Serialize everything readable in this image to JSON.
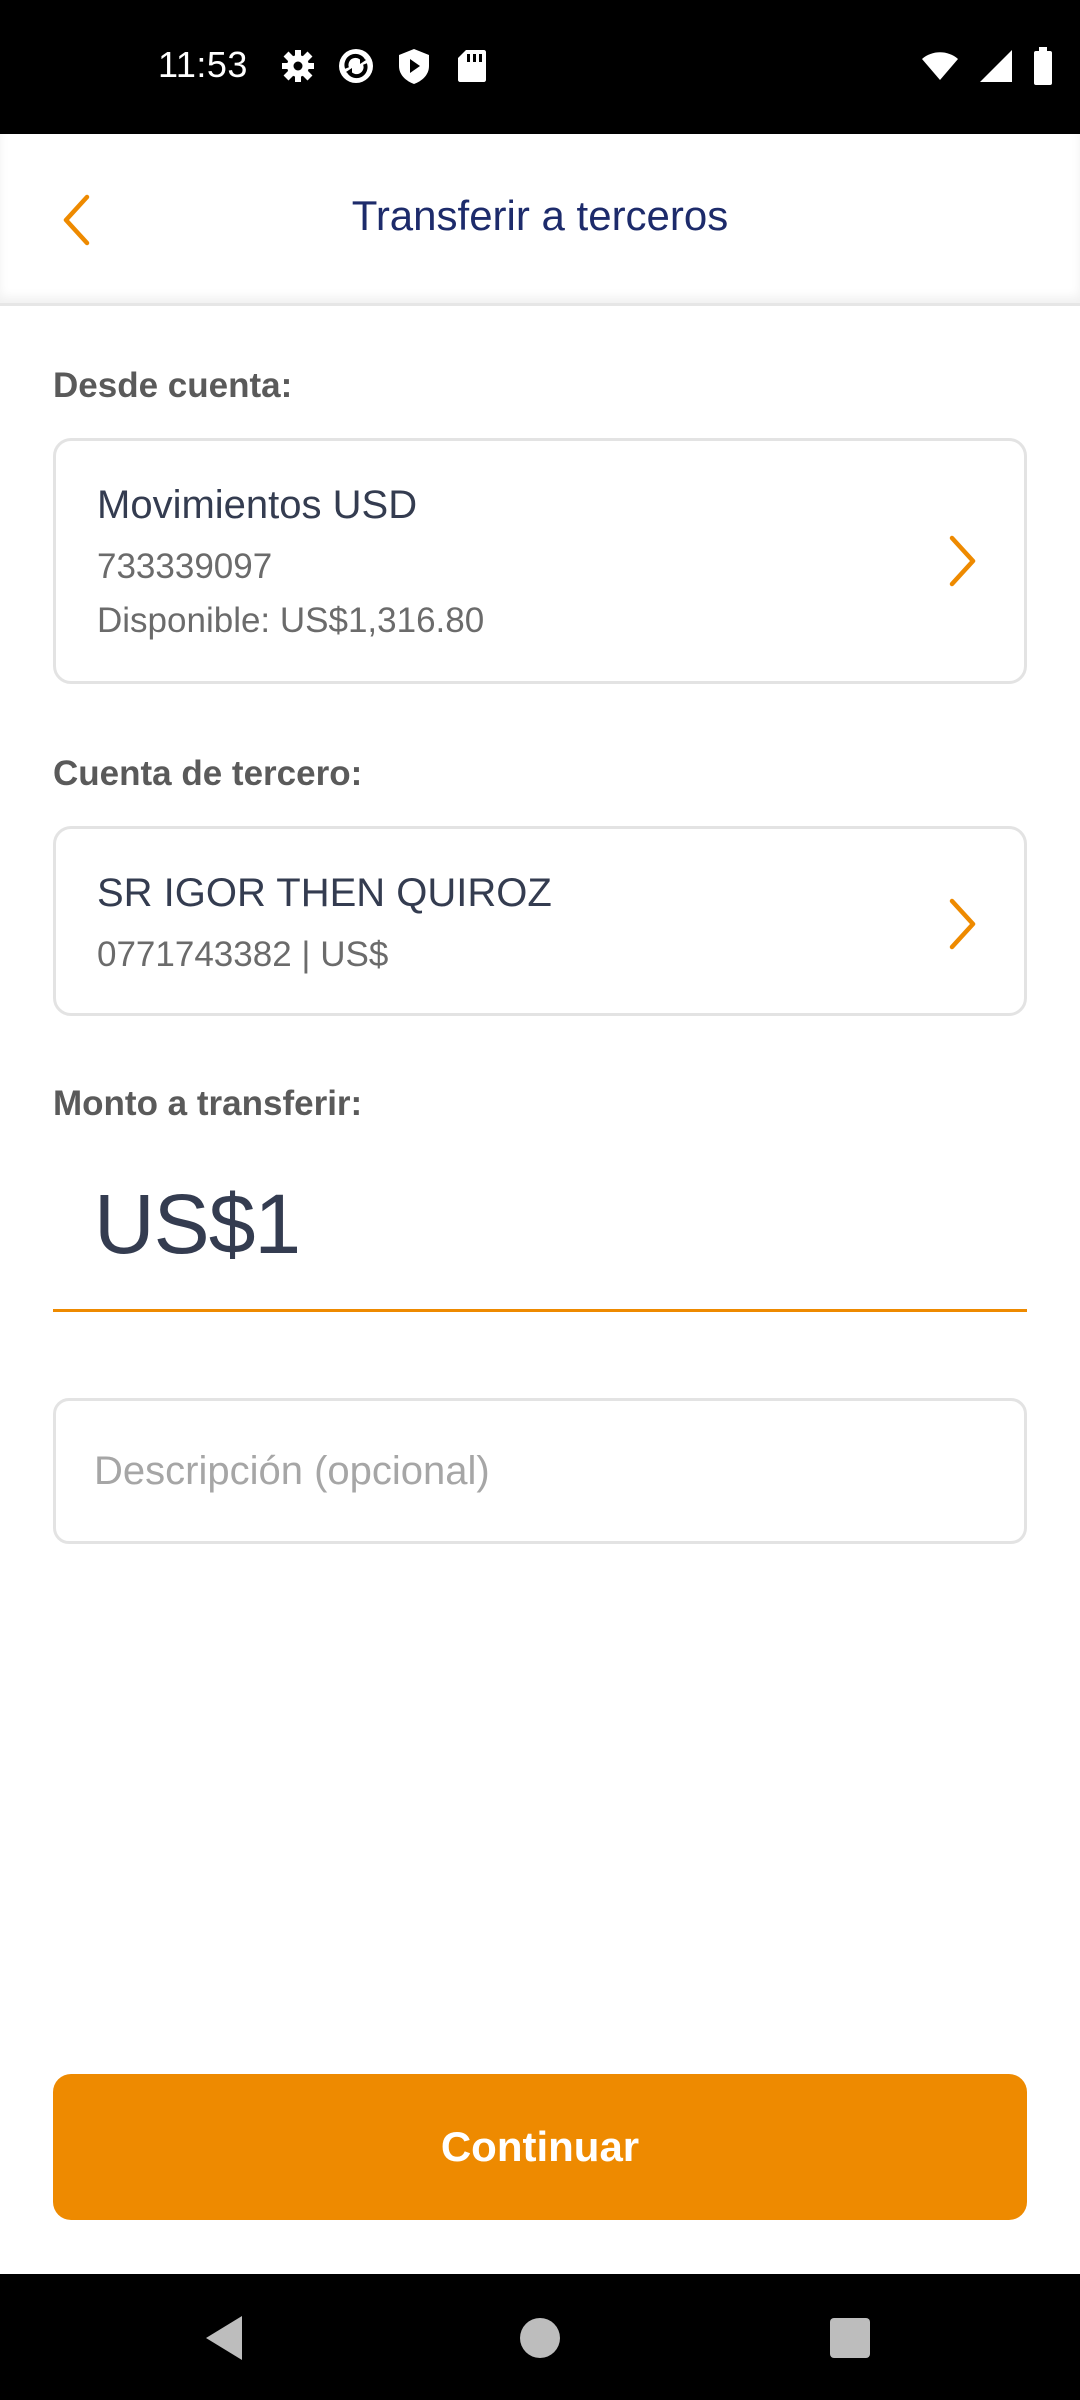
{
  "status_bar": {
    "time": "11:53",
    "left_icons": [
      "settings-icon",
      "sync-icon",
      "shield-icon",
      "sd-card-icon"
    ],
    "right_icons": [
      "wifi-icon",
      "signal-icon",
      "battery-icon"
    ]
  },
  "header": {
    "title": "Transferir a terceros",
    "back_icon": "chevron-left-icon"
  },
  "from_account": {
    "label": "Desde cuenta:",
    "name": "Movimientos USD",
    "number": "733339097",
    "available": "Disponible: US$1,316.80"
  },
  "third_party": {
    "label": "Cuenta de tercero:",
    "name": "SR IGOR THEN QUIROZ",
    "details": "0771743382 | US$"
  },
  "amount": {
    "label": "Monto a transferir:",
    "value": "US$1"
  },
  "description": {
    "placeholder": "Descripción (opcional)",
    "value": ""
  },
  "continue_label": "Continuar",
  "nav_bar": {
    "icons": [
      "back-triangle-icon",
      "home-circle-icon",
      "recents-square-icon"
    ]
  },
  "colors": {
    "accent": "#ee8a00",
    "title": "#1d2b6b",
    "text": "#343c50",
    "border": "#e3e3e3"
  }
}
